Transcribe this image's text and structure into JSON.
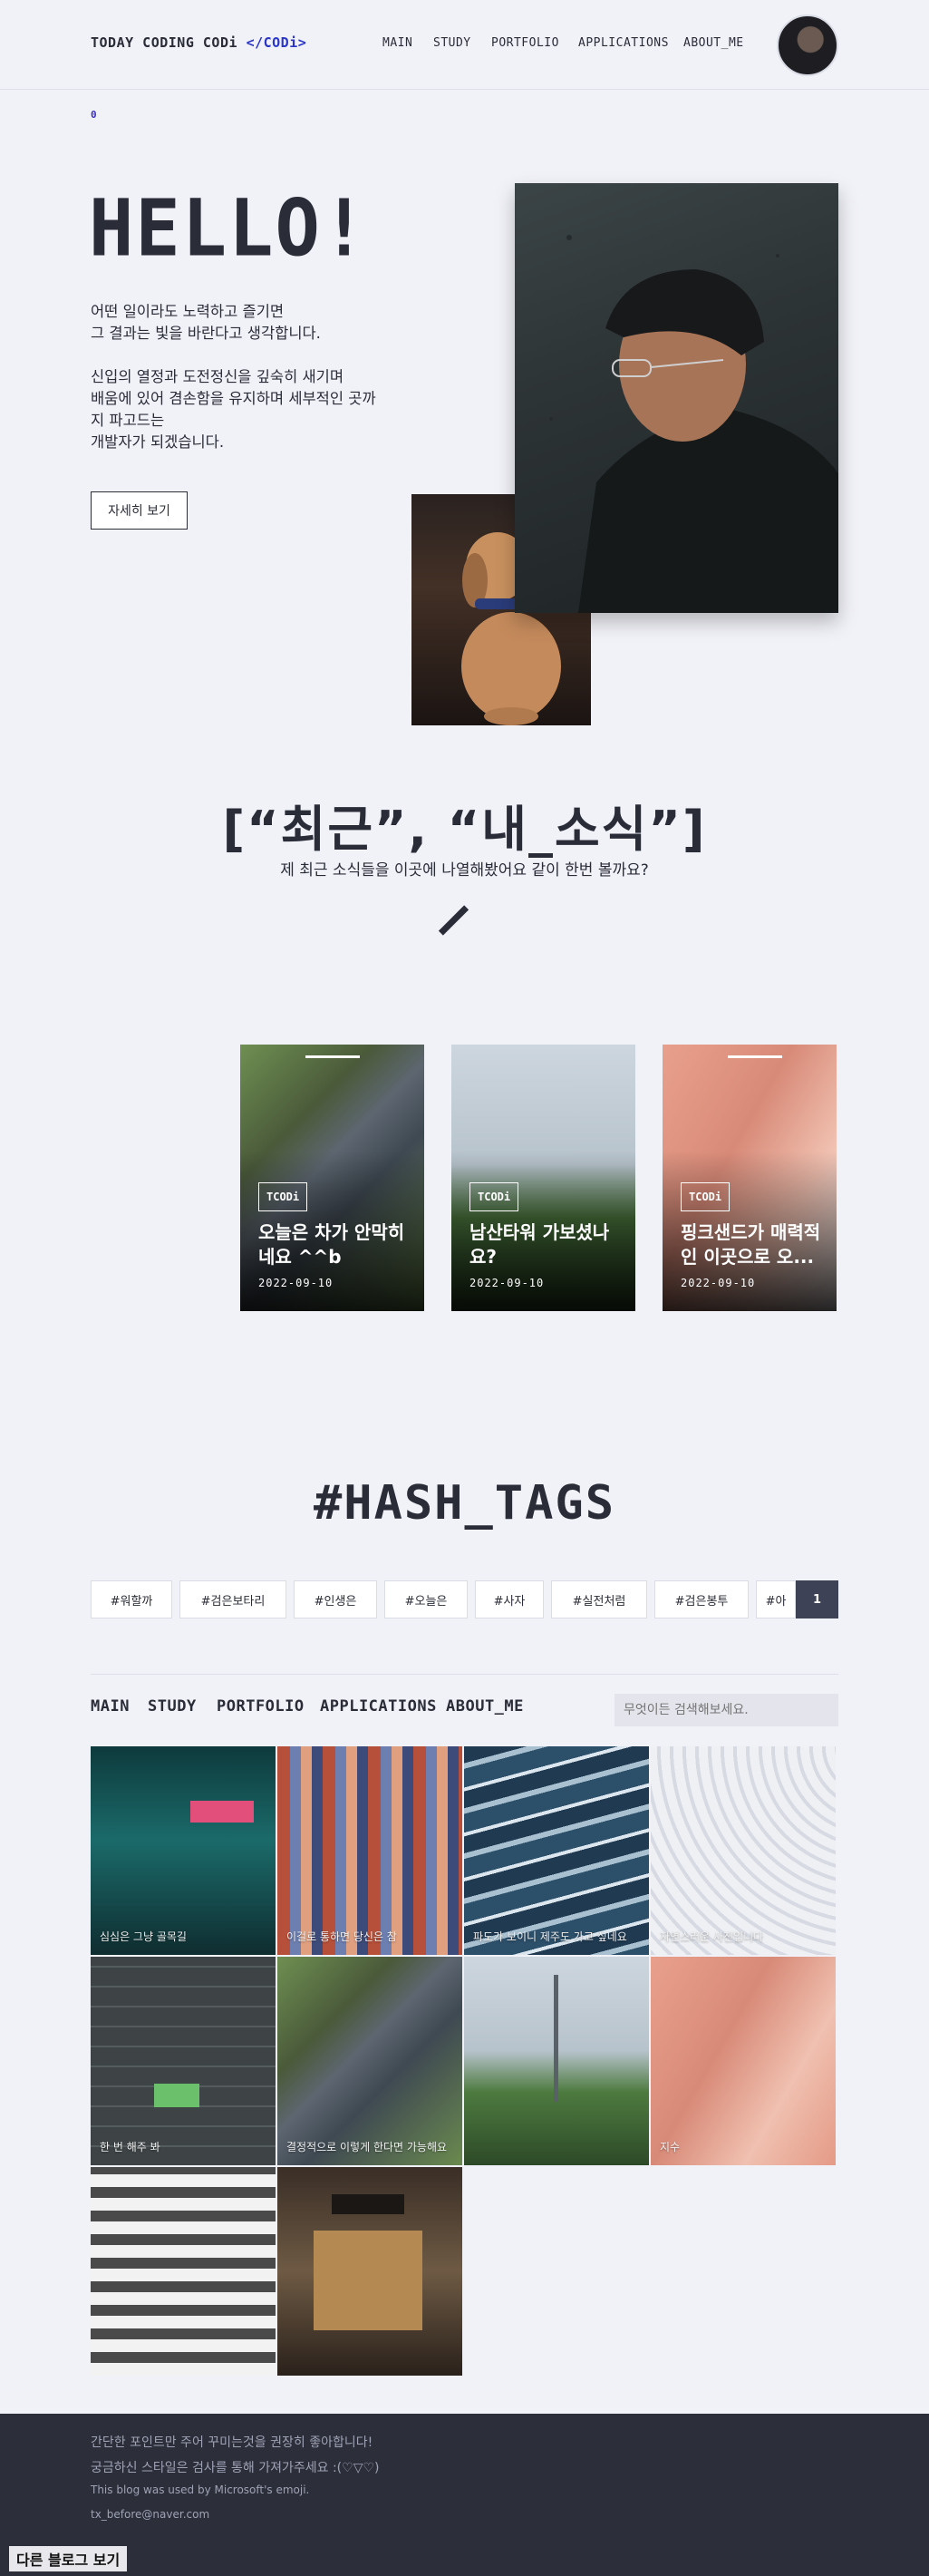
{
  "header": {
    "brand": "TODAY CODING CODi",
    "brand_code": "</CODi>",
    "nav": [
      "MAIN",
      "STUDY",
      "PORTFOLIO",
      "APPLICATIONS",
      "ABOUT_ME"
    ]
  },
  "marker": "0",
  "hero": {
    "hello": "HELLO!",
    "lines1": [
      "어떤 일이라도 노력하고 즐기면",
      "그 결과는 빛을 바란다고 생각합니다."
    ],
    "lines2": [
      "신입의 열정과 도전정신을 깊숙히 새기며",
      "배움에 있어 겸손함을 유지하며 세부적인 곳까",
      "지 파고드는",
      "개발자가 되겠습니다."
    ],
    "button": "자세히 보기"
  },
  "news": {
    "title": "[“최근”, “내_소식”]",
    "subtitle": "제 최근 소식들을 이곳에 나열해봤어요 같이 한번 볼까요?",
    "cards": [
      {
        "tag": "TCODi",
        "title": "오늘은 차가 안막히네요 ^^b",
        "date": "2022-09-10"
      },
      {
        "tag": "TCODi",
        "title": "남산타워 가보셨나요?",
        "date": "2022-09-10"
      },
      {
        "tag": "TCODi",
        "title": "핑크샌드가 매력적인 이곳으로 오...",
        "date": "2022-09-10"
      }
    ]
  },
  "hashtags": {
    "title": "#HASH_TAGS",
    "tags": [
      "#워할까",
      "#검은보타리",
      "#인생은",
      "#오늘은",
      "#사자",
      "#실전처럼",
      "#검은봉투",
      "#아"
    ],
    "page": "1"
  },
  "gallery_nav": {
    "items": [
      "MAIN",
      "STUDY",
      "PORTFOLIO",
      "APPLICATIONS",
      "ABOUT_ME"
    ],
    "search_placeholder": "무엇이든 검색해보세요."
  },
  "gallery": [
    {
      "label": "심심은 그냥 골목길"
    },
    {
      "label": "이걸로 통하면 당신은 참"
    },
    {
      "label": "파도가 보이니 제주도 가고 싶네요"
    },
    {
      "label": "자연스러운 사진입니다"
    },
    {
      "label": "한 번 해주 봐"
    },
    {
      "label": "결정적으로 이렇게 한다면 가능해요"
    },
    {
      "label": ""
    },
    {
      "label": "지수"
    },
    {
      "label": ""
    },
    {
      "label": ""
    }
  ],
  "footer": {
    "lines": [
      "간단한 포인트만 주어 꾸미는것을 권장히 좋아합니다!",
      "궁금하신 스타일은 검사를 통해 가져가주세요 :(♡▽♡)",
      "This blog was used by Microsoft's emoji.",
      "tx_before@naver.com"
    ],
    "blog_link": "다른 블로그 보기"
  }
}
